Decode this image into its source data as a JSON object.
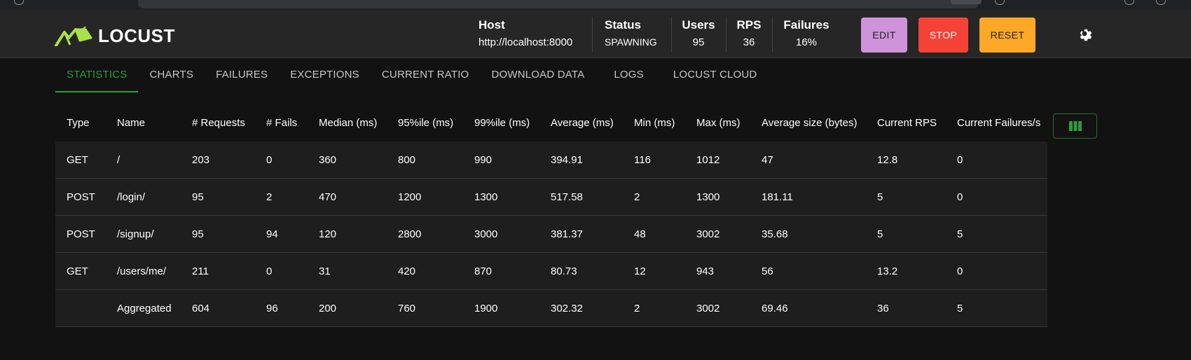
{
  "header": {
    "logo_text": "LOCUST",
    "stats": [
      {
        "label": "Host",
        "value": "http://localhost:8000"
      },
      {
        "label": "Status",
        "value": "SPAWNING"
      },
      {
        "label": "Users",
        "value": "95"
      },
      {
        "label": "RPS",
        "value": "36"
      },
      {
        "label": "Failures",
        "value": "16%"
      }
    ],
    "buttons": {
      "edit": "EDIT",
      "stop": "STOP",
      "reset": "RESET"
    },
    "theme_icon": "gear-icon",
    "colors": {
      "edit": "#ce93d8",
      "stop": "#f44336",
      "reset": "#ffa726",
      "accent": "#2e9c3a"
    }
  },
  "tabs": [
    {
      "label": "STATISTICS",
      "active": true
    },
    {
      "label": "CHARTS"
    },
    {
      "label": "FAILURES"
    },
    {
      "label": "EXCEPTIONS"
    },
    {
      "label": "CURRENT RATIO"
    },
    {
      "label": "DOWNLOAD DATA"
    },
    {
      "label": "LOGS"
    },
    {
      "label": "LOCUST CLOUD"
    }
  ],
  "table": {
    "columns": [
      "Type",
      "Name",
      "# Requests",
      "# Fails",
      "Median (ms)",
      "95%ile (ms)",
      "99%ile (ms)",
      "Average (ms)",
      "Min (ms)",
      "Max (ms)",
      "Average size (bytes)",
      "Current RPS",
      "Current Failures/s"
    ],
    "rows": [
      [
        "GET",
        "/",
        "203",
        "0",
        "360",
        "800",
        "990",
        "394.91",
        "116",
        "1012",
        "47",
        "12.8",
        "0"
      ],
      [
        "POST",
        "/login/",
        "95",
        "2",
        "470",
        "1200",
        "1300",
        "517.58",
        "2",
        "1300",
        "181.11",
        "5",
        "0"
      ],
      [
        "POST",
        "/signup/",
        "95",
        "94",
        "120",
        "2800",
        "3000",
        "381.37",
        "48",
        "3002",
        "35.68",
        "5",
        "5"
      ],
      [
        "GET",
        "/users/me/",
        "211",
        "0",
        "31",
        "420",
        "870",
        "80.73",
        "12",
        "943",
        "56",
        "13.2",
        "0"
      ],
      [
        "",
        "Aggregated",
        "604",
        "96",
        "200",
        "760",
        "1900",
        "302.32",
        "2",
        "3002",
        "69.46",
        "36",
        "5"
      ]
    ],
    "column_toggle_icon": "view-columns-icon"
  }
}
